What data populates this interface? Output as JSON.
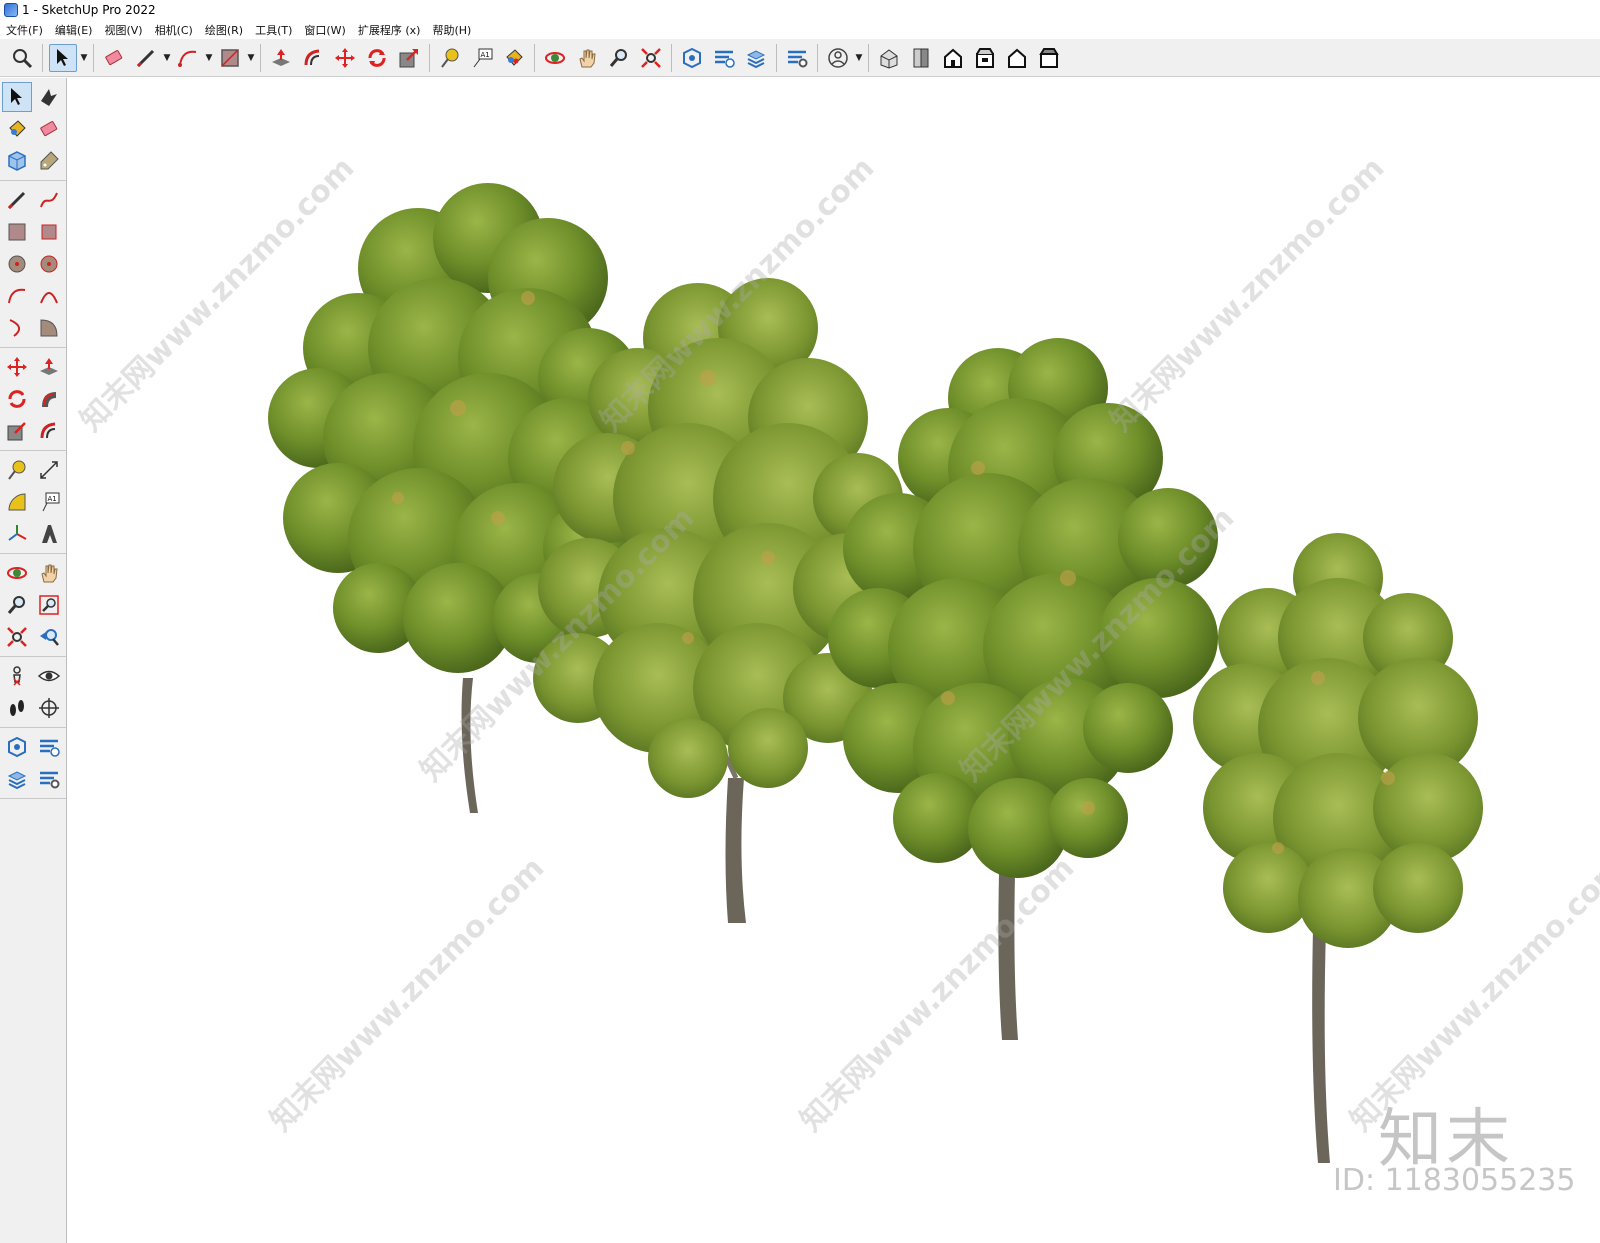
{
  "window": {
    "title": "1 - SketchUp Pro 2022",
    "app_icon": "sketchup-logo-icon"
  },
  "menu": [
    {
      "label": "文件(F)"
    },
    {
      "label": "编辑(E)"
    },
    {
      "label": "视图(V)"
    },
    {
      "label": "相机(C)"
    },
    {
      "label": "绘图(R)"
    },
    {
      "label": "工具(T)"
    },
    {
      "label": "窗口(W)"
    },
    {
      "label": "扩展程序 (x)"
    },
    {
      "label": "帮助(H)"
    }
  ],
  "toolbar": {
    "tools": [
      {
        "icon": "zoom-icon"
      },
      {
        "icon": "select-arrow-icon",
        "active": true,
        "dropdown": true
      },
      {
        "icon": "eraser-icon"
      },
      {
        "icon": "pencil-line-icon",
        "dropdown": true
      },
      {
        "icon": "arc-icon",
        "dropdown": true
      },
      {
        "icon": "rectangle-icon",
        "dropdown": true
      },
      {
        "icon": "push-pull-icon"
      },
      {
        "icon": "offset-icon"
      },
      {
        "icon": "move-icon"
      },
      {
        "icon": "rotate-icon"
      },
      {
        "icon": "scale-icon"
      },
      {
        "icon": "tape-measure-icon"
      },
      {
        "icon": "text-label-icon"
      },
      {
        "icon": "paint-bucket-icon"
      },
      {
        "icon": "orbit-icon"
      },
      {
        "icon": "pan-hand-icon"
      },
      {
        "icon": "zoom-glass-icon"
      },
      {
        "icon": "zoom-extents-icon"
      },
      {
        "icon": "3d-warehouse-icon"
      },
      {
        "icon": "extension-warehouse-icon"
      },
      {
        "icon": "layout-send-icon"
      },
      {
        "icon": "extension-manager-icon"
      },
      {
        "icon": "user-account-icon",
        "dropdown": true
      },
      {
        "icon": "view-iso-icon"
      },
      {
        "icon": "view-top-icon"
      },
      {
        "icon": "view-front-icon"
      },
      {
        "icon": "view-right-icon"
      },
      {
        "icon": "view-back-icon"
      },
      {
        "icon": "view-left-icon"
      }
    ]
  },
  "left_toolbar": {
    "tools": [
      "select-icon",
      "orbit-small-icon",
      "paint-icon",
      "eraser-small-icon",
      "component-icon",
      "tag-icon",
      "line-icon",
      "freehand-icon",
      "rectangle-small-icon",
      "rotated-rectangle-icon",
      "circle-icon",
      "polygon-icon",
      "arc-small-icon",
      "two-point-arc-icon",
      "three-point-arc-icon",
      "pie-icon",
      "move-small-icon",
      "push-pull-small-icon",
      "rotate-small-icon",
      "follow-me-icon",
      "scale-small-icon",
      "offset-small-icon",
      "tape-small-icon",
      "dimension-icon",
      "protractor-icon",
      "text-icon",
      "axes-icon",
      "3d-text-icon",
      "orbit-tool-icon",
      "pan-tool-icon",
      "zoom-tool-icon",
      "zoom-window-icon",
      "zoom-extents-small-icon",
      "previous-view-icon",
      "position-camera-icon",
      "look-around-icon",
      "walk-icon",
      "section-plane-icon",
      "warehouse-small-icon",
      "extension-warehouse-small-icon",
      "layout-small-icon",
      "extension-manager-small-icon"
    ]
  },
  "watermark": {
    "text": "知末网www.znzmo.com",
    "logo": "知末",
    "id": "ID: 1183055235"
  },
  "scene": {
    "trees": 4,
    "foliage_color": "#6f8f2a",
    "trunk_color": "#6b6659"
  }
}
